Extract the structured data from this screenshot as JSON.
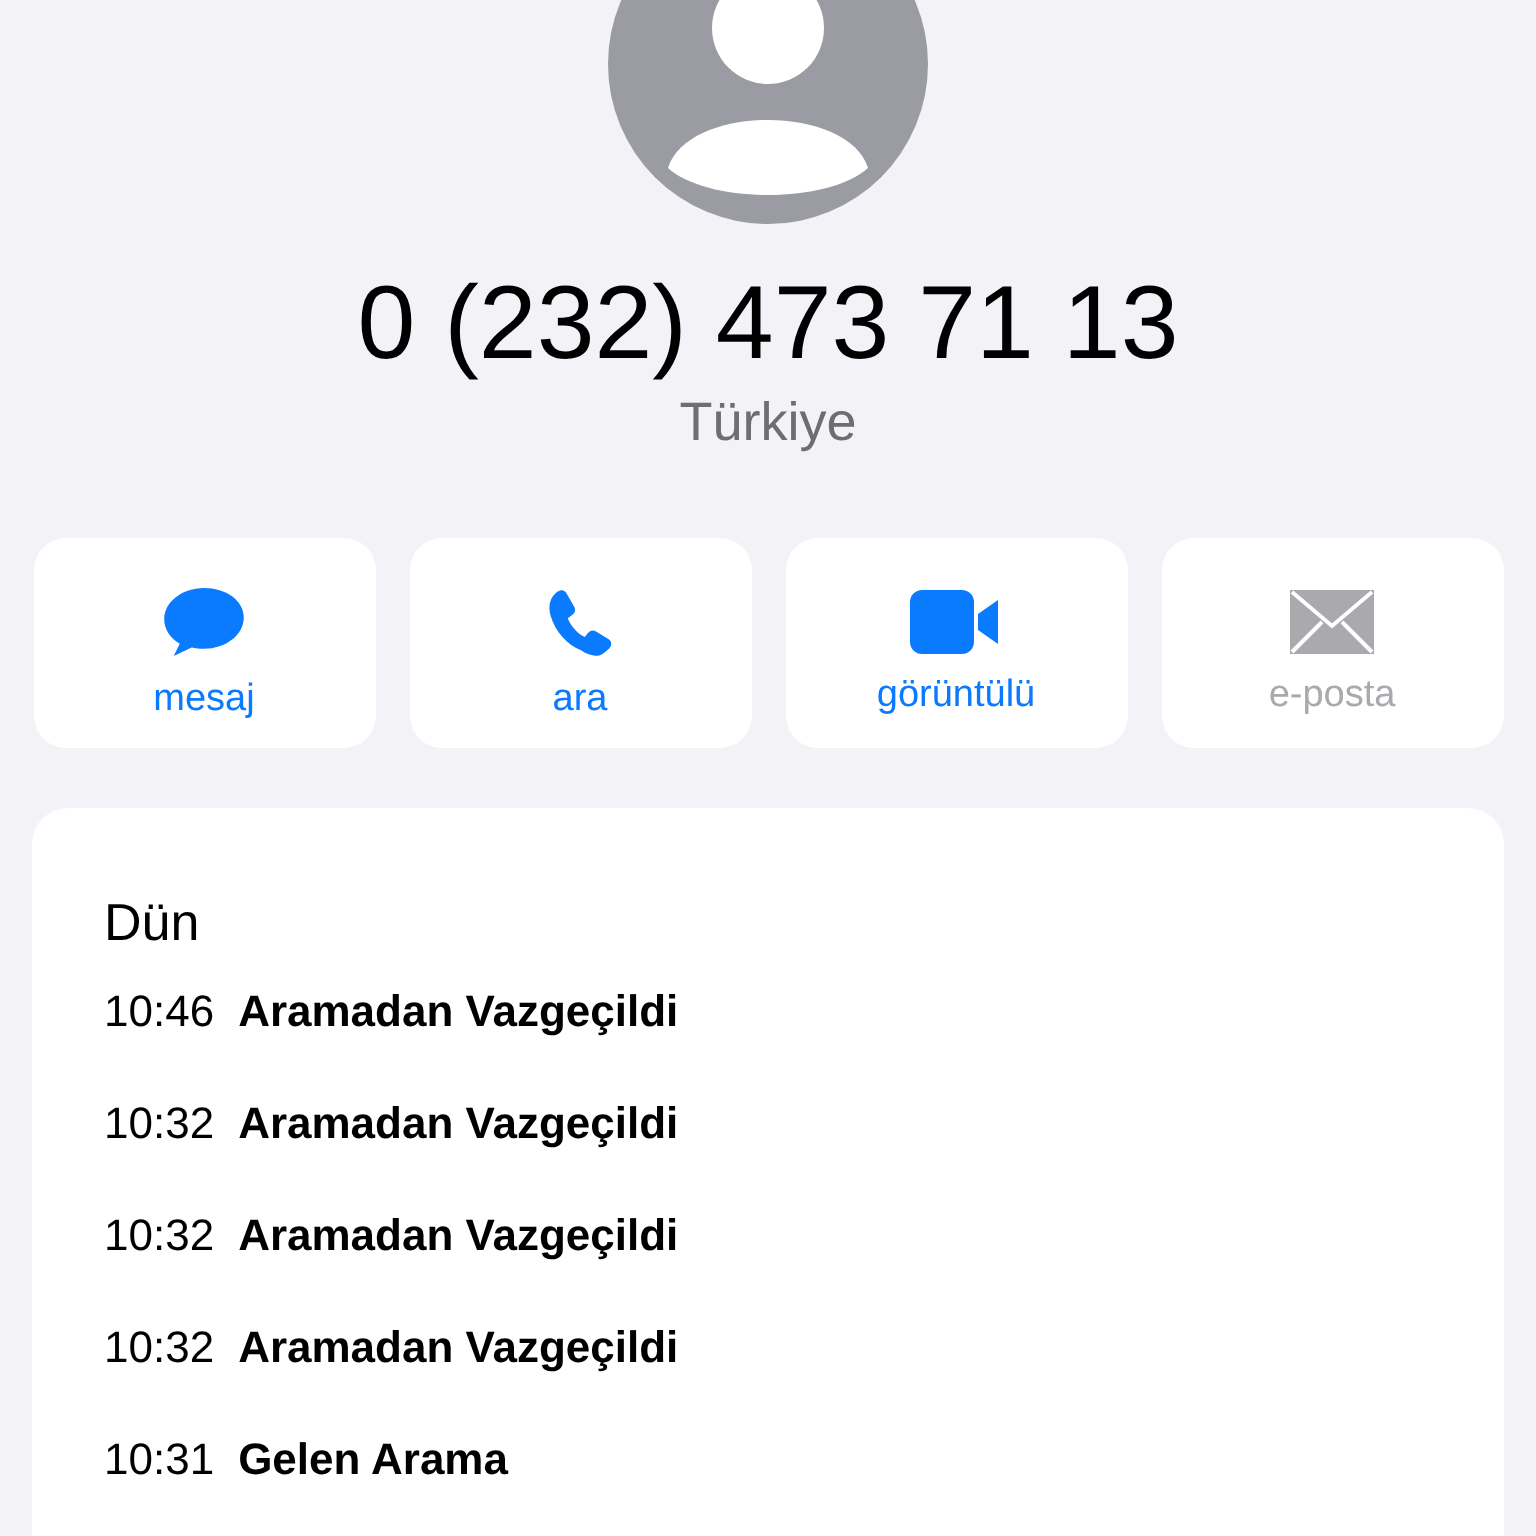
{
  "contact": {
    "number": "0 (232) 473 71 13",
    "country": "Türkiye"
  },
  "actions": [
    {
      "kind": "message",
      "label": "mesaj",
      "disabled": false
    },
    {
      "kind": "phone",
      "label": "ara",
      "disabled": false
    },
    {
      "kind": "video",
      "label": "görüntülü",
      "disabled": false
    },
    {
      "kind": "mail",
      "label": "e-posta",
      "disabled": true
    }
  ],
  "history": {
    "day": "Dün",
    "calls": [
      {
        "time": "10:46",
        "type": "Aramadan Vazgeçildi"
      },
      {
        "time": "10:32",
        "type": "Aramadan Vazgeçildi"
      },
      {
        "time": "10:32",
        "type": "Aramadan Vazgeçildi"
      },
      {
        "time": "10:32",
        "type": "Aramadan Vazgeçildi"
      },
      {
        "time": "10:31",
        "type": "Gelen Arama"
      }
    ]
  }
}
